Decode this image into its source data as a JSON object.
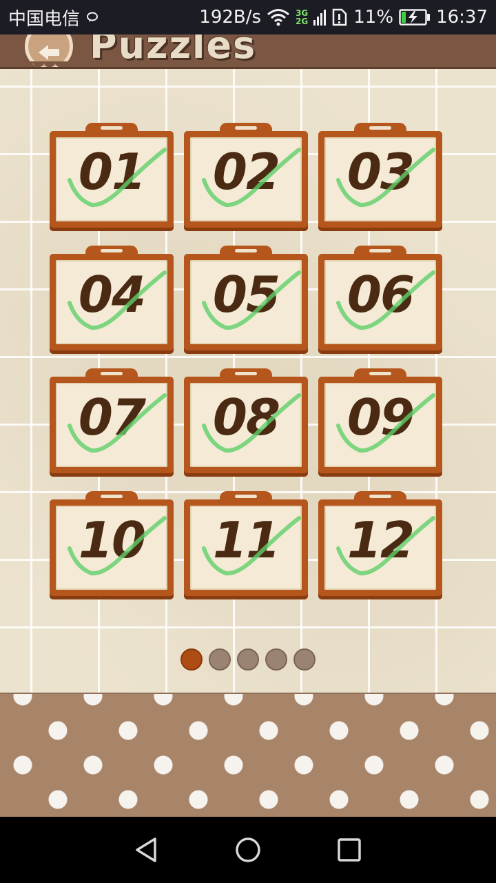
{
  "status_bar": {
    "carrier": "中国电信",
    "net_speed": "192B/s",
    "net_3g": "3G",
    "net_2g": "2G",
    "battery": "11%",
    "time": "16:37"
  },
  "header": {
    "title": "Puzzles"
  },
  "puzzles": [
    {
      "label": "01",
      "completed": true
    },
    {
      "label": "02",
      "completed": true
    },
    {
      "label": "03",
      "completed": true
    },
    {
      "label": "04",
      "completed": true
    },
    {
      "label": "05",
      "completed": true
    },
    {
      "label": "06",
      "completed": true
    },
    {
      "label": "07",
      "completed": true
    },
    {
      "label": "08",
      "completed": true
    },
    {
      "label": "09",
      "completed": true
    },
    {
      "label": "10",
      "completed": true
    },
    {
      "label": "11",
      "completed": true
    },
    {
      "label": "12",
      "completed": true
    }
  ],
  "pagination": {
    "pages": 5,
    "current": 1
  },
  "colors": {
    "tile_frame": "#b5561c",
    "check_mark": "#5fd06a",
    "number_ink": "#4a2a12",
    "active_dot": "#ad4d13"
  }
}
